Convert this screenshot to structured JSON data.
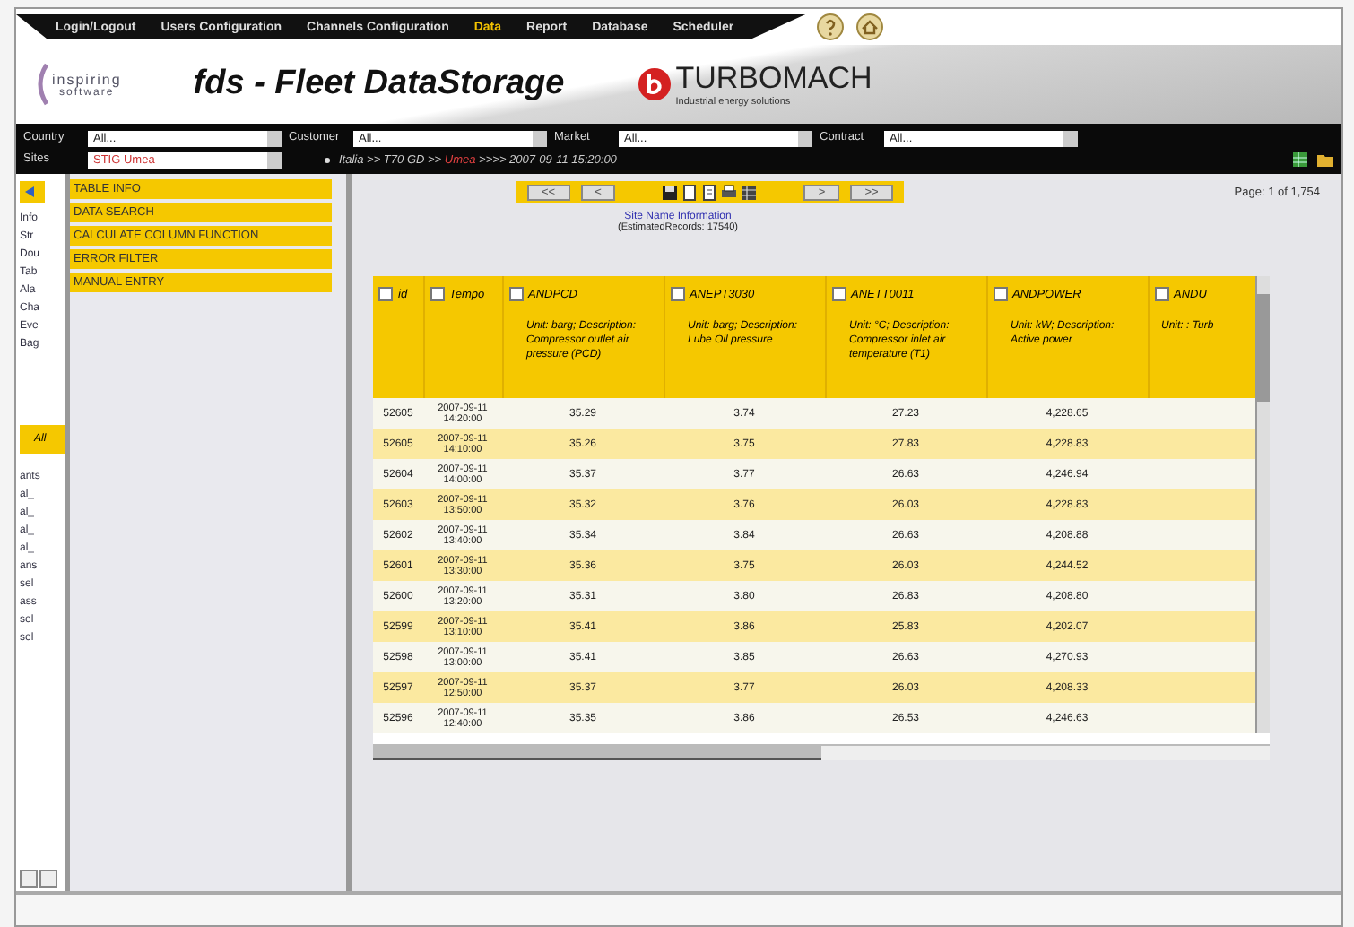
{
  "nav": {
    "items": [
      {
        "label": "Login/Logout",
        "selected": false
      },
      {
        "label": "Users Configuration",
        "selected": false
      },
      {
        "label": "Channels Configuration",
        "selected": false
      },
      {
        "label": "Data",
        "selected": true
      },
      {
        "label": "Report",
        "selected": false
      },
      {
        "label": "Database",
        "selected": false
      },
      {
        "label": "Scheduler",
        "selected": false
      }
    ]
  },
  "header": {
    "company": "inspiring",
    "company_sub": "software",
    "title": "fds - Fleet DataStorage",
    "brand": "TURBOMACH",
    "tagline": "Industrial energy solutions"
  },
  "filters": {
    "first_row": [
      {
        "label": "Country",
        "value": "All..."
      },
      {
        "label": "Customer",
        "value": "All..."
      },
      {
        "label": "Market",
        "value": "All..."
      },
      {
        "label": "Contract",
        "value": "All..."
      }
    ],
    "site": {
      "label": "Sites",
      "value": "STIG Umea"
    },
    "breadcrumb": [
      {
        "text": "Italia >> T70 GD >> ",
        "highlighted": false
      },
      {
        "text": "Umea",
        "highlighted": true
      },
      {
        "text": " >>>> 2007-09-11 15:20:00",
        "highlighted": false
      }
    ]
  },
  "side_strip": {
    "top_items": [
      "Info",
      "Str",
      "Dou",
      "Tab",
      "Ala",
      "Cha",
      "Eve",
      "Bag"
    ],
    "section": "All",
    "bottom_items": [
      "ants",
      "al_",
      "al_",
      "al_",
      "al_",
      "ans",
      "sel",
      "ass",
      "sel",
      "sel"
    ]
  },
  "menu": {
    "items": [
      {
        "label": "TABLE INFO"
      },
      {
        "label": "DATA SEARCH"
      },
      {
        "label": "CALCULATE COLUMN FUNCTION"
      },
      {
        "label": "ERROR FILTER"
      },
      {
        "label": "MANUAL ENTRY"
      }
    ]
  },
  "pager": {
    "first": "<<",
    "prev": "<",
    "next": ">",
    "last": ">>",
    "page": "Page: 1 of 1,754"
  },
  "site_link": "Site Name Information",
  "records": "(EstimatedRecords: 17540)",
  "table": {
    "columns": [
      {
        "code": "id",
        "checked": false
      },
      {
        "code": "Tempo",
        "checked": false
      },
      {
        "code": "ANDPCD",
        "description": "Unit: barg; Description: Compressor outlet air pressure (PCD)",
        "checked": false
      },
      {
        "code": "ANEPT3030",
        "description": "Unit: barg; Description: Lube Oil pressure",
        "checked": false
      },
      {
        "code": "ANETT0011",
        "description": "Unit: °C; Description: Compressor inlet air temperature (T1)",
        "checked": false
      },
      {
        "code": "ANDPOWER",
        "description": "Unit: kW; Description: Active power",
        "checked": false
      },
      {
        "code": "ANDU",
        "description": "Unit: : Turb",
        "checked": false
      }
    ],
    "rows": [
      [
        "52605",
        "2007-09-11 14:20:00",
        "35.29",
        "3.74",
        "27.23",
        "4,228.65"
      ],
      [
        "52605",
        "2007-09-11 14:10:00",
        "35.26",
        "3.75",
        "27.83",
        "4,228.83"
      ],
      [
        "52604",
        "2007-09-11 14:00:00",
        "35.37",
        "3.77",
        "26.63",
        "4,246.94"
      ],
      [
        "52603",
        "2007-09-11 13:50:00",
        "35.32",
        "3.76",
        "26.03",
        "4,228.83"
      ],
      [
        "52602",
        "2007-09-11 13:40:00",
        "35.34",
        "3.84",
        "26.63",
        "4,208.88"
      ],
      [
        "52601",
        "2007-09-11 13:30:00",
        "35.36",
        "3.75",
        "26.03",
        "4,244.52"
      ],
      [
        "52600",
        "2007-09-11 13:20:00",
        "35.31",
        "3.80",
        "26.83",
        "4,208.80"
      ],
      [
        "52599",
        "2007-09-11 13:10:00",
        "35.41",
        "3.86",
        "25.83",
        "4,202.07"
      ],
      [
        "52598",
        "2007-09-11 13:00:00",
        "35.41",
        "3.85",
        "26.63",
        "4,270.93"
      ],
      [
        "52597",
        "2007-09-11 12:50:00",
        "35.37",
        "3.77",
        "26.03",
        "4,208.33"
      ],
      [
        "52596",
        "2007-09-11 12:40:00",
        "35.35",
        "3.86",
        "26.53",
        "4,246.63"
      ]
    ]
  }
}
